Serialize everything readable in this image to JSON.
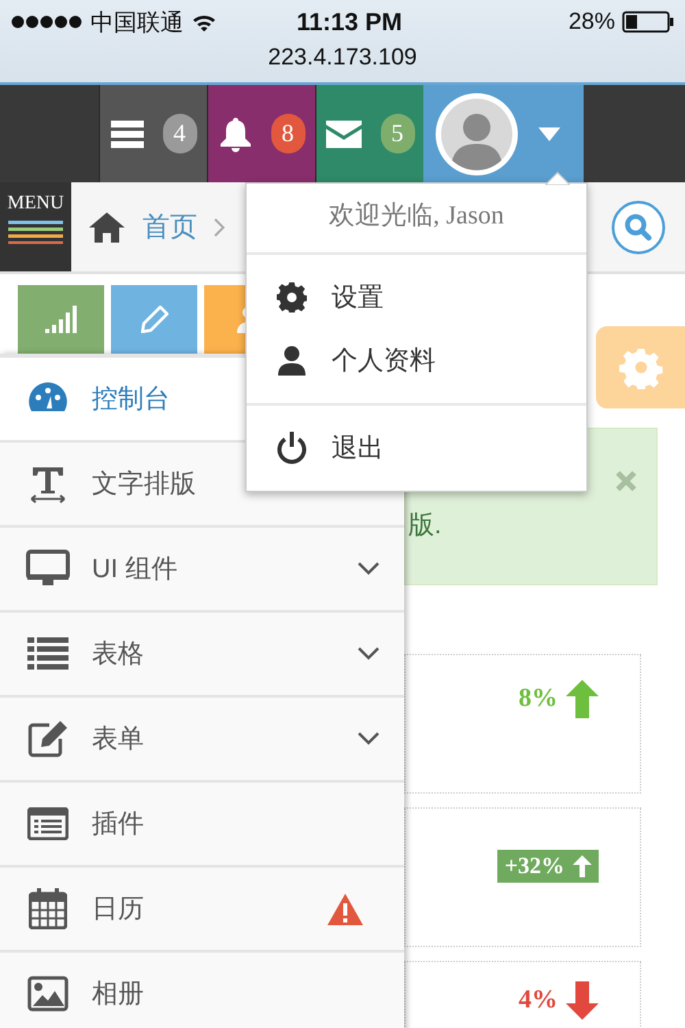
{
  "status_bar": {
    "carrier": "中国联通",
    "time": "11:13 PM",
    "battery": "28%",
    "address": "223.4.173.109"
  },
  "navbar": {
    "tiles": [
      {
        "kind": "tasks",
        "color": "#555555",
        "badge": {
          "text": "4",
          "color": "#9a9a9a"
        }
      },
      {
        "kind": "bell",
        "color": "#892e6c",
        "badge": {
          "text": "8",
          "color": "#e2583e"
        }
      },
      {
        "kind": "mail",
        "color": "#2e8a68",
        "badge": {
          "text": "5",
          "color": "#7fae6c"
        }
      }
    ],
    "user": {
      "color": "#5a9fd0",
      "expanded": true
    }
  },
  "breadcrumb": {
    "menu_label": "MENU",
    "items": [
      {
        "label": "首页"
      }
    ]
  },
  "shortcuts": [
    {
      "kind": "chart",
      "color": "#82af6f"
    },
    {
      "kind": "pencil",
      "color": "#6fb3e0"
    },
    {
      "kind": "users",
      "color": "#fcb24c"
    }
  ],
  "sidebar": {
    "items": [
      {
        "kind": "dashboard",
        "label": "控制台",
        "selected": true,
        "submenu": false,
        "warning": false
      },
      {
        "kind": "text",
        "label": "文字排版",
        "selected": false,
        "submenu": false,
        "warning": false
      },
      {
        "kind": "desktop",
        "label": "UI 组件",
        "selected": false,
        "submenu": true,
        "warning": false
      },
      {
        "kind": "list",
        "label": "表格",
        "selected": false,
        "submenu": true,
        "warning": false
      },
      {
        "kind": "edit",
        "label": "表单",
        "selected": false,
        "submenu": true,
        "warning": false
      },
      {
        "kind": "card",
        "label": "插件",
        "selected": false,
        "submenu": false,
        "warning": false
      },
      {
        "kind": "calendar",
        "label": "日历",
        "selected": false,
        "submenu": false,
        "warning": true
      },
      {
        "kind": "picture",
        "label": "相册",
        "selected": false,
        "submenu": false,
        "warning": false
      }
    ]
  },
  "alert": {
    "text": "版."
  },
  "stats": [
    {
      "kind": "plain",
      "value": "8%",
      "rising": true
    },
    {
      "kind": "label",
      "value": "+32%",
      "rising": true
    },
    {
      "kind": "plain",
      "value": "4%",
      "rising": false
    }
  ],
  "user_menu": {
    "greeting": "欢迎光临, Jason",
    "groups": [
      [
        {
          "kind": "settings",
          "label": "设置"
        },
        {
          "kind": "profile",
          "label": "个人资料"
        }
      ],
      [
        {
          "kind": "logout",
          "label": "退出"
        }
      ]
    ]
  }
}
